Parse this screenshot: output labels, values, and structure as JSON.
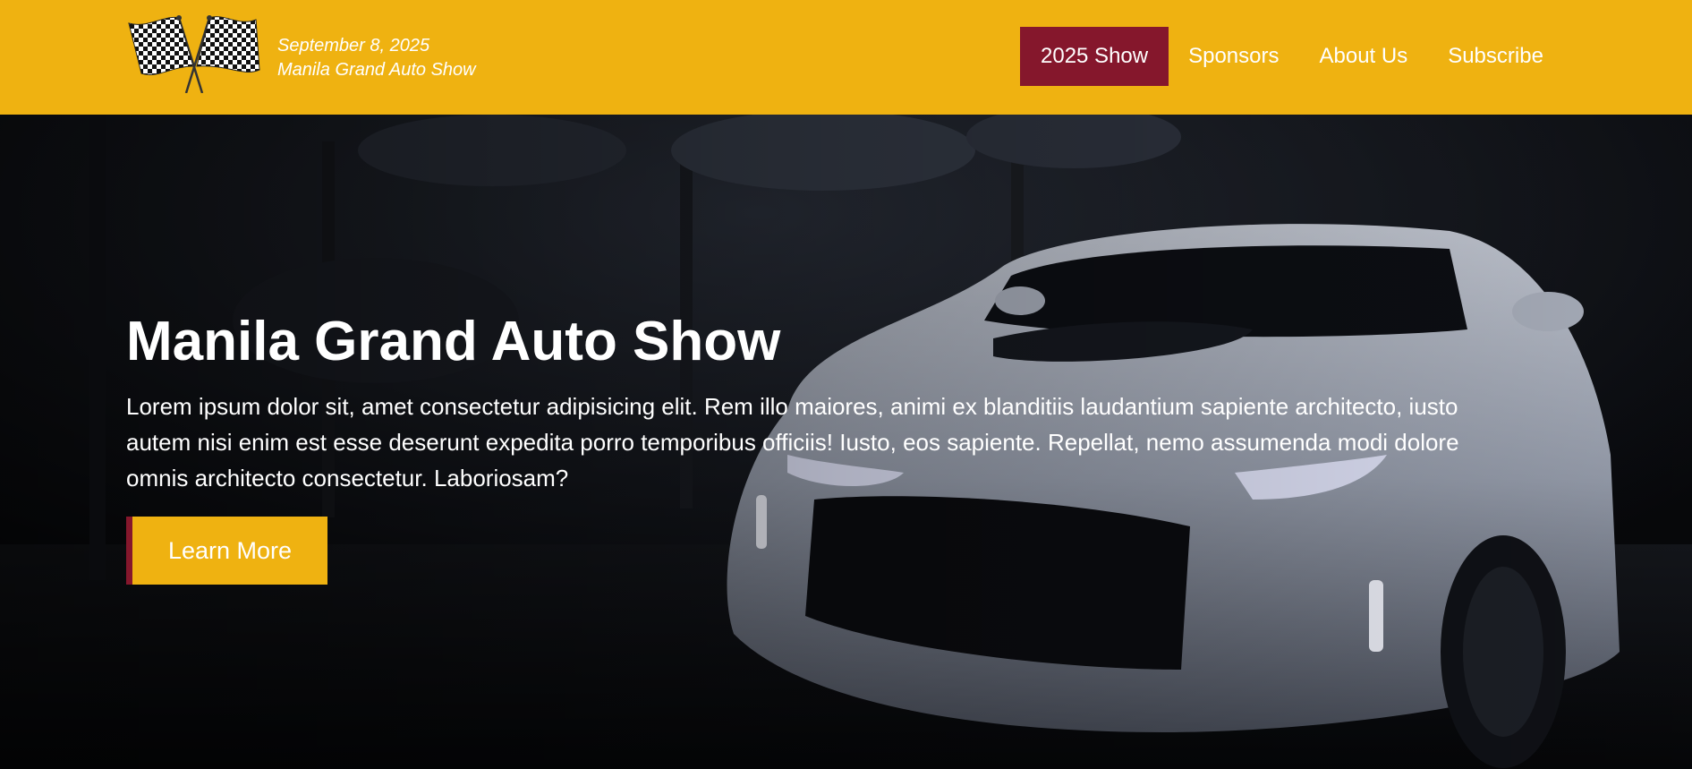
{
  "header": {
    "date": "September 8, 2025",
    "event_name": "Manila Grand Auto Show",
    "logo_icon": "checkered-flags-icon",
    "background_color": "#EFB211"
  },
  "nav": {
    "items": [
      {
        "label": "2025 Show",
        "active": true
      },
      {
        "label": "Sponsors",
        "active": false
      },
      {
        "label": "About Us",
        "active": false
      },
      {
        "label": "Subscribe",
        "active": false
      }
    ],
    "active_color": "#85172C"
  },
  "hero": {
    "title": "Manila Grand Auto Show",
    "text": "Lorem ipsum dolor sit, amet consectetur adipisicing elit. Rem illo maiores, animi ex blanditiis laudantium sapiente architecto, iusto autem nisi enim est esse deserunt expedita porro temporibus officiis! Iusto, eos sapiente. Repellat, nemo assumenda modi dolore omnis architecto consectetur. Laboriosam?",
    "button_label": "Learn More",
    "background_image": "white-sports-car-in-dark-garage"
  }
}
